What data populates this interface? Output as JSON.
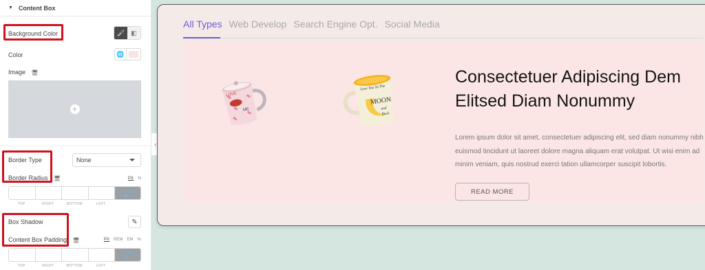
{
  "panel": {
    "section_title": "Content Box",
    "background_color_label": "Background Color",
    "color_label": "Color",
    "image_label": "Image",
    "border_type_label": "Border Type",
    "border_type_value": "None",
    "border_radius_label": "Border Radius",
    "border_radius_units": [
      "PX",
      "%"
    ],
    "dimension_labels": [
      "TOP",
      "RIGHT",
      "BOTTOM",
      "LEFT"
    ],
    "box_shadow_label": "Box Shadow",
    "padding_label": "Content Box Padding",
    "padding_units": [
      "PX",
      "REM",
      "EM",
      "%"
    ],
    "swatch_color": "#fbe3e4"
  },
  "preview": {
    "tabs": [
      "All Types",
      "Web Develop",
      "Search Engine Opt.",
      "Social Media"
    ],
    "active_tab": "All Types",
    "heading": "Consectetuer Adipiscing Dem Elitsed Diam Nonummy",
    "body": "Lorem ipsum dolor sit amet, consectetuer adipiscing elit, sed diam nonummy nibh euismod tincidunt ut laoreet dolore magna aliquam erat volutpat. Ut wisi enim ad minim veniam, quis nostrud exerci tation ullamcorper suscipit lobortis.",
    "button_label": "READ MORE",
    "mug1_text": [
      "LOVE",
      "ME"
    ],
    "mug2_text": [
      "Love You To The",
      "MOON",
      "and",
      "Back"
    ],
    "accent_color": "#6a5bd6",
    "card_bg": "#fbe6e5"
  },
  "colors": {
    "highlight": "#d0101a",
    "canvas_bg": "#d5e6e0"
  }
}
